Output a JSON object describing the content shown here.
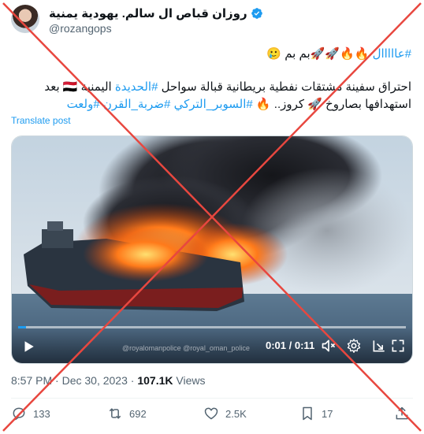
{
  "author": {
    "display_name": "روزان قباص ال سالم. يهودية يمنية",
    "handle": "@rozangops",
    "verified_icon": "verified-badge-icon"
  },
  "tweet": {
    "line1_tag": "#عااااال",
    "line1_text": " 🔥🔥🚀🚀بم بم 🥲",
    "line2_a": "احتراق سفينة مشتقات نفطية بريطانية قبالة سواحل ",
    "line2_tag": "#الحديدة",
    "line2_b": " اليمنية 🇾🇪 بعد",
    "line3_a": "استهدافها بصاروخ 🚀 كروز.. 🔥 ",
    "line3_tags": "#السوبر_التركي #ضربة_القرن #ولعت"
  },
  "translate_label": "Translate post",
  "video": {
    "time_current": "0:01",
    "time_separator": " / ",
    "time_total": "0:11",
    "progress_fraction": 0.02,
    "watermark": "@royalomanpolice @royal_oman_police"
  },
  "meta": {
    "time": "8:57 PM",
    "sep": " · ",
    "date": "Dec 30, 2023",
    "views_count": "107.1K",
    "views_label": " Views"
  },
  "actions": {
    "replies": "133",
    "reposts": "692",
    "likes": "2.5K",
    "bookmarks": "17"
  },
  "colors": {
    "accent": "#1d9bf0",
    "cross": "#e8473f"
  }
}
